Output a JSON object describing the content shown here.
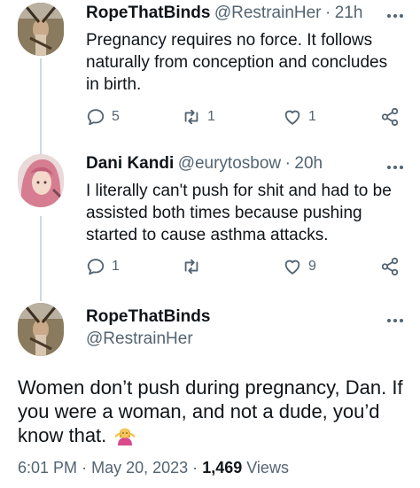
{
  "tweet1": {
    "author_name": "RopeThatBinds",
    "handle": "@RestrainHer",
    "separator": "·",
    "time": "21h",
    "text": "Pregnancy requires no force. It follows naturally from conception and concludes in birth.",
    "reply_count": "5",
    "retweet_count": "1",
    "like_count": "1"
  },
  "tweet2": {
    "author_name": "Dani Kandi",
    "handle": "@eurytosbow",
    "separator": "·",
    "time": "20h",
    "text": "I literally can't push for shit and had to be assisted both times because pushing started to cause asthma attacks.",
    "reply_count": "1",
    "retweet_count": "",
    "like_count": "9"
  },
  "main_tweet": {
    "author_name": "RopeThatBinds",
    "handle": "@RestrainHer",
    "text": "Women don’t push during pregnancy, Dan. If you were a woman, and not a dude, you’d know that.",
    "emoji": "woman-shrugging-emoji",
    "time": "6:01 PM",
    "separator": "·",
    "date": "May 20, 2023",
    "views_count": "1,469",
    "views_label": "Views"
  },
  "icons": {
    "more": "more-horizontal-icon",
    "reply": "reply-icon",
    "retweet": "retweet-icon",
    "like": "like-icon",
    "share": "share-icon"
  },
  "colors": {
    "text": "#0f1419",
    "secondary": "#536471",
    "thread_line": "#cfd9de"
  }
}
